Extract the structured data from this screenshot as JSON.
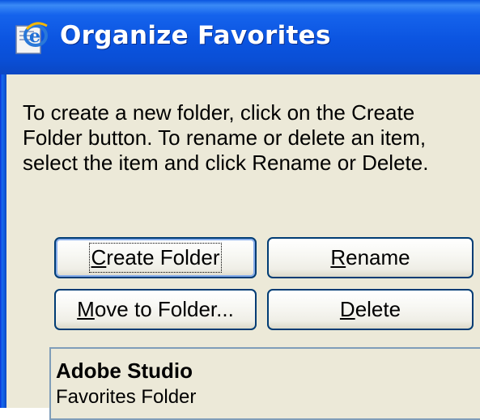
{
  "window": {
    "title": "Organize Favorites",
    "icon": "ie-favorites-icon"
  },
  "instructions": "To create a new folder, click on the Create Folder button. To rename or delete an item, select the item and click Rename or Delete.",
  "buttons": {
    "create_folder": {
      "before": "",
      "mnemonic": "C",
      "after": "reate Folder"
    },
    "rename": {
      "before": "",
      "mnemonic": "R",
      "after": "ename"
    },
    "move_to_folder": {
      "before": "",
      "mnemonic": "M",
      "after": "ove to Folder..."
    },
    "delete": {
      "before": "",
      "mnemonic": "D",
      "after": "elete"
    }
  },
  "selected_item": {
    "name": "Adobe Studio",
    "type": "Favorites Folder"
  },
  "colors": {
    "titlebar": "#0b54e0",
    "dialog_bg": "#ece9d8",
    "button_border": "#003c74",
    "list_border": "#7f9db9"
  }
}
